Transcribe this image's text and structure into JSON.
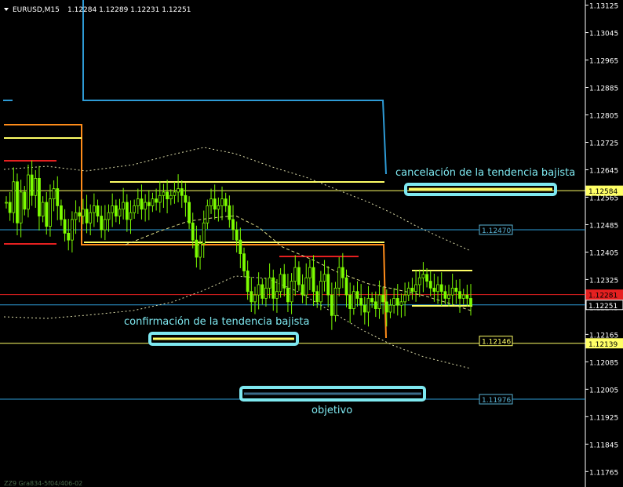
{
  "header": {
    "symbol": "EURUSD,M15",
    "ohlc": "1.12284 1.12289 1.12231 1.12251"
  },
  "footer_text": "ZZ9 Gra834-5f04/406-02",
  "annotations": {
    "cancel_text": "cancelación de la tendencia bajista",
    "confirm_text": "confirmación de la tendencia bajista",
    "target_text": "objetivo"
  },
  "colors": {
    "background": "#000000",
    "candle": "#7CFC00",
    "blue_line": "#2E9BD6",
    "yellow": "#FFFF66",
    "orange": "#FF8C1A",
    "red": "#E52020",
    "cyan": "#7EE8F0",
    "dotted": "#DDDDAA",
    "grid_text": "#FFFFFF"
  },
  "chart_data": {
    "type": "candlestick",
    "symbol": "EURUSD",
    "timeframe": "M15",
    "ylim": [
      1.1172,
      1.1314
    ],
    "y_ticks": [
      "1.13125",
      "1.13045",
      "1.12965",
      "1.12885",
      "1.12805",
      "1.12725",
      "1.12645",
      "1.12565",
      "1.12485",
      "1.12405",
      "1.12325",
      "1.12245",
      "1.12165",
      "1.12085",
      "1.12005",
      "1.11925",
      "1.11845",
      "1.11765"
    ],
    "price_markers": [
      {
        "value": "1.12584",
        "color": "#FFFF66",
        "type": "axis"
      },
      {
        "value": "1.12470",
        "color": "#5AB4D6",
        "type": "inline"
      },
      {
        "value": "1.12281",
        "color": "#E52020",
        "type": "axis"
      },
      {
        "value": "1.12251",
        "color": "#FFFFFF",
        "type": "axis"
      },
      {
        "value": "1.12146",
        "color": "#FFFF66",
        "type": "inline"
      },
      {
        "value": "1.12139",
        "color": "#FFFF66",
        "type": "axis"
      },
      {
        "value": "1.11976",
        "color": "#5AB4D6",
        "type": "inline"
      }
    ],
    "horizontal_lines": [
      {
        "price": 1.12584,
        "color": "#FFFF66",
        "from": 0.0,
        "to": 1.0
      },
      {
        "price": 1.1247,
        "color": "#2E9BD6",
        "from": 0.0,
        "to": 1.0
      },
      {
        "price": 1.12281,
        "color": "#E52020",
        "from": 0.0,
        "to": 1.0
      },
      {
        "price": 1.12251,
        "color": "#2E9BD6",
        "from": 0.0,
        "to": 1.0
      },
      {
        "price": 1.12139,
        "color": "#FFFF66",
        "from": 0.0,
        "to": 1.0
      },
      {
        "price": 1.11976,
        "color": "#2E9BD6",
        "from": 0.0,
        "to": 1.0
      }
    ],
    "close_series": [
      1.1255,
      1.1252,
      1.1261,
      1.1249,
      1.1258,
      1.1253,
      1.1263,
      1.1257,
      1.1262,
      1.1251,
      1.1255,
      1.1248,
      1.1256,
      1.1259,
      1.1254,
      1.125,
      1.1246,
      1.1244,
      1.125,
      1.1252,
      1.1251,
      1.1253,
      1.1249,
      1.1252,
      1.1254,
      1.1251,
      1.1247,
      1.125,
      1.1252,
      1.1254,
      1.1251,
      1.1253,
      1.1255,
      1.125,
      1.1252,
      1.1254,
      1.1256,
      1.1253,
      1.1255,
      1.1254,
      1.1256,
      1.1255,
      1.1257,
      1.1258,
      1.1256,
      1.1257,
      1.1258,
      1.1259,
      1.1257,
      1.1255,
      1.1249,
      1.1244,
      1.1239,
      1.1243,
      1.1249,
      1.1254,
      1.1256,
      1.1253,
      1.1254,
      1.1256,
      1.1254,
      1.125,
      1.1247,
      1.1244,
      1.124,
      1.1235,
      1.1229,
      1.1226,
      1.1228,
      1.1231,
      1.1227,
      1.123,
      1.1233,
      1.1227,
      1.1229,
      1.1234,
      1.123,
      1.1226,
      1.1232,
      1.1236,
      1.1231,
      1.1228,
      1.1233,
      1.1236,
      1.1229,
      1.1226,
      1.1232,
      1.1234,
      1.1228,
      1.1222,
      1.123,
      1.1236,
      1.1233,
      1.1228,
      1.1224,
      1.1229,
      1.1227,
      1.1225,
      1.1223,
      1.1227,
      1.1226,
      1.1224,
      1.1228,
      1.1226,
      1.1223,
      1.1225,
      1.1227,
      1.1225,
      1.1226,
      1.1228,
      1.123,
      1.1229,
      1.1231,
      1.1233,
      1.1234,
      1.1232,
      1.123,
      1.1229,
      1.1231,
      1.1229,
      1.1227,
      1.1228,
      1.123,
      1.1229,
      1.1227,
      1.1228,
      1.1227,
      1.1225
    ]
  }
}
